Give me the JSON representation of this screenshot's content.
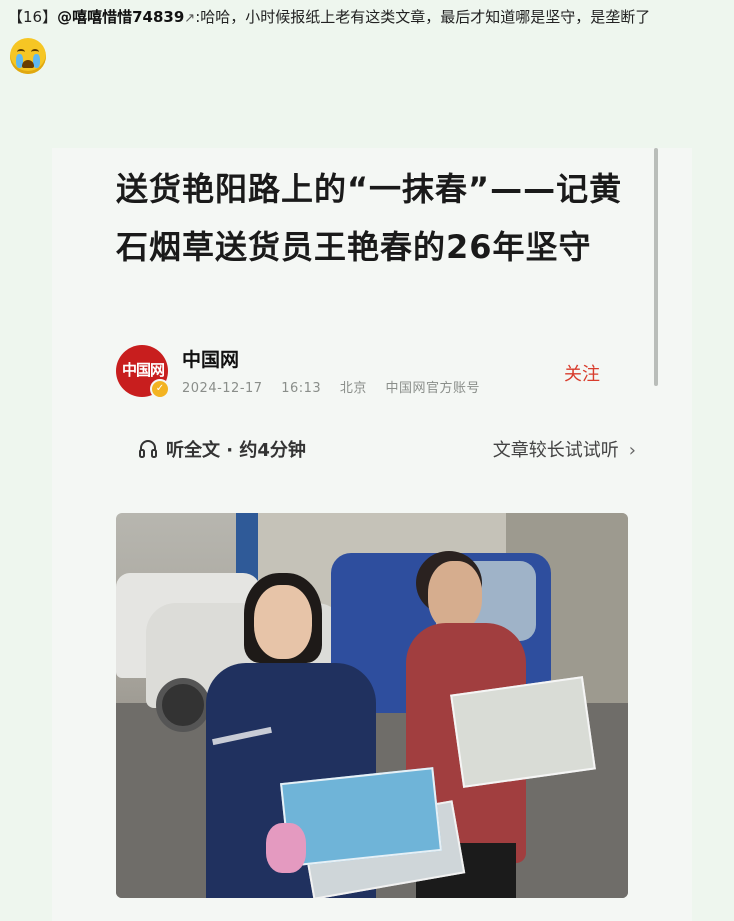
{
  "comment": {
    "index": "【16】",
    "username": "@嘻嘻惜惜74839",
    "link_mark": "↗",
    "text": ":哈哈，小时候报纸上老有这类文章，最后才知道哪是坚守，是垄断了"
  },
  "emoji": {
    "name": "crying-face-icon"
  },
  "article": {
    "title": "送货艳阳路上的“一抹春”——记黄石烟草送货员王艳春的26年坚守",
    "source": {
      "avatar_text": "中国网",
      "name": "中国网",
      "date": "2024-12-17",
      "time": "16:13",
      "location": "北京",
      "account": "中国网官方账号"
    },
    "follow_label": "关注",
    "listen": {
      "label_prefix": "听全文",
      "separator": " · ",
      "duration": "约4分钟",
      "try_label": "文章较长试试听",
      "chevron": "›"
    }
  },
  "colors": {
    "background": "#eef6ee",
    "follow": "#d83c2c",
    "avatar": "#c81e1e"
  }
}
